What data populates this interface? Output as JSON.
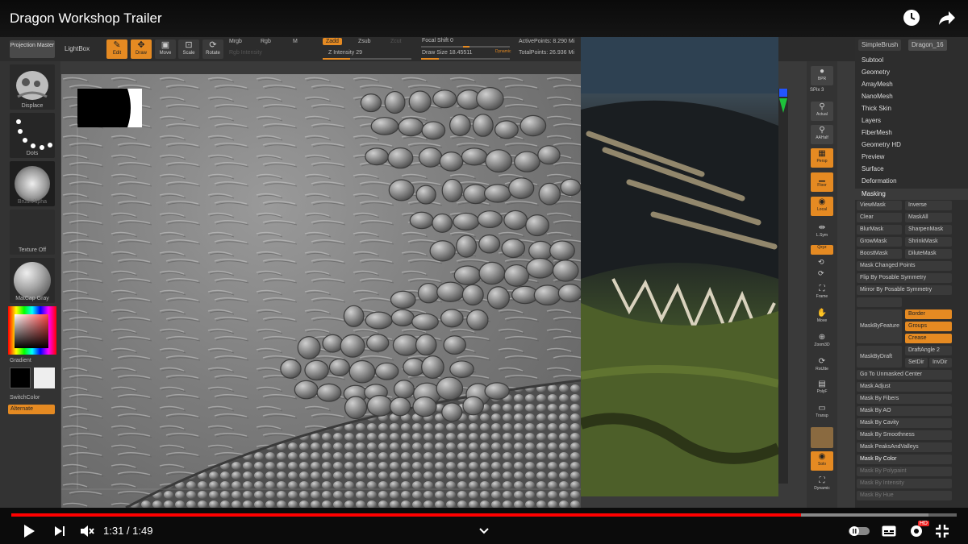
{
  "video": {
    "title": "Dragon Workshop Trailer",
    "time_current": "1:31",
    "time_separator": " / ",
    "time_total": "1:49",
    "progress": 0.835,
    "buffered": 0.97,
    "icons": [
      "watch-later-icon",
      "share-icon",
      "play-icon",
      "next-icon",
      "mute-icon",
      "chevron-down-icon",
      "autoplay-toggle-icon",
      "subtitles-icon",
      "settings-icon",
      "fullscreen-exit-icon"
    ],
    "hd_badge": "HD"
  },
  "toolbar": {
    "projection_master": "Projection Master",
    "lightbox": "LightBox",
    "edit": "Edit",
    "draw": "Draw",
    "move": "Move",
    "scale": "Scale",
    "rotate": "Rotate",
    "mrgb": "Mrgb",
    "rgb": "Rgb",
    "m": "M",
    "rgb_intensity": "Rgb Intensity",
    "zadd": "Zadd",
    "zsub": "Zsub",
    "zcut": "Zcut",
    "z_intensity": "Z Intensity 29",
    "focal_shift": "Focal Shift 0",
    "draw_size": "Draw Size 18.45511",
    "dynamic": "Dynamic",
    "active_points": "ActivePoints: 8.290 Mi",
    "total_points": "TotalPoints: 26.936 Mi",
    "accent_color": "#e58a22"
  },
  "left_shelf": {
    "brush": "Displace",
    "stroke": "Dots",
    "alpha": "BrushAlpha",
    "texture": "Texture Off",
    "material": "MatCap Gray",
    "gradient": "Gradient",
    "switch_color": "SwitchColor",
    "alternate": "Alternate"
  },
  "right_column": {
    "bpr": "BPR",
    "spix": "SPix 3",
    "actual": "Actual",
    "aahalf": "AAHalf",
    "persp": "Persp",
    "floor": "Floor",
    "local": "Local",
    "lsym": "L.Sym",
    "xyz": "Qxyz",
    "frame": "Frame",
    "move": "Move",
    "zoom3d": "Zoom3D",
    "rotate": "RotJtte",
    "polyf": "PolyF",
    "transp": "Transp",
    "solo": "Solo",
    "dynamic": "Dynamic"
  },
  "panel": {
    "tab_simplebrush": "SimpleBrush",
    "tab_dragon": "Dragon_16",
    "items": [
      "Subtool",
      "Geometry",
      "ArrayMesh",
      "NanoMesh",
      "Thick Skin",
      "Layers",
      "FiberMesh",
      "Geometry HD",
      "Preview",
      "Surface",
      "Deformation"
    ],
    "masking": "Masking",
    "viewmask": "ViewMask",
    "inverse": "Inverse",
    "clear": "Clear",
    "maskall": "MaskAll",
    "blurmask": "BlurMask",
    "sharpenmask": "SharpenMask",
    "growmask": "GrowMask",
    "shrinkmask": "ShrinkMask",
    "boostmask": "BoostMask",
    "dilutemask": "DiluteMask",
    "mask_changed_points": "Mask Changed Points",
    "flip_posable": "Flip By Posable Symmetry",
    "mirror_posable": "Mirror By Posable Symmetry",
    "mask_by_feature": "MaskByFeature",
    "border": "Border",
    "groups": "Groups",
    "crease": "Crease",
    "mask_by_draft": "MaskByDraft",
    "draft_angle": "DraftAngle 2",
    "setdir": "SetDir",
    "invdir": "InvDir",
    "go_unmasked": "Go To Unmasked Center",
    "mask_adjust": "Mask Adjust",
    "mask_fibers": "Mask By Fibers",
    "mask_ao": "Mask By AO",
    "mask_cavity": "Mask By Cavity",
    "mask_smoothness": "Mask By Smoothness",
    "mask_peaks": "Mask PeaksAndValleys",
    "mask_color": "Mask By Color",
    "mask_polypaint": "Mask By Polypaint",
    "mask_intensity": "Mask By Intensity",
    "mask_hue": "Mask By Hue"
  }
}
